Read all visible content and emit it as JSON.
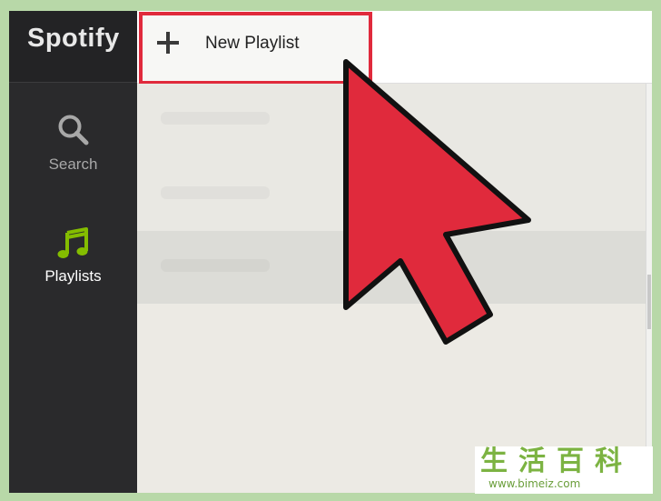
{
  "sidebar": {
    "brand": "Spotify",
    "items": [
      {
        "label": "Search",
        "icon": "search-icon"
      },
      {
        "label": "Playlists",
        "icon": "music-note-icon"
      }
    ]
  },
  "toolbar": {
    "new_playlist_label": "New Playlist",
    "plus_icon": "plus-icon"
  },
  "overlay": {
    "cursor_icon": "mouse-pointer-icon",
    "cursor_color": "#e02a3c",
    "highlight_color": "#e02a3c"
  },
  "watermark": {
    "chars": "生活百科",
    "url": "www.bimeiz.com"
  },
  "colors": {
    "sidebar_bg": "#2a2a2c",
    "accent_green": "#84bd00",
    "page_bg": "#b8d8a8"
  }
}
